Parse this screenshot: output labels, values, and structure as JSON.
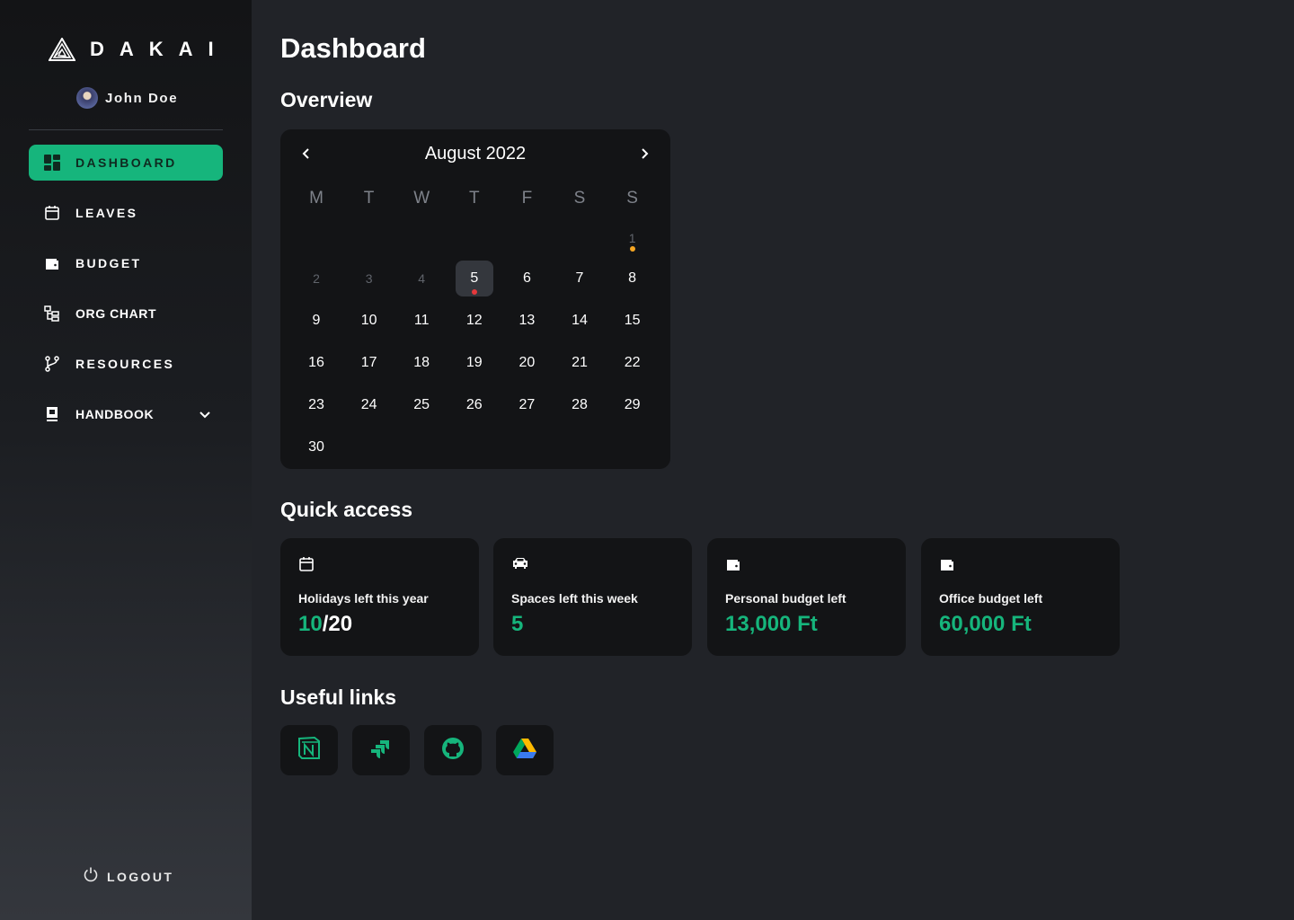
{
  "brand": {
    "name": "DAKAI"
  },
  "user": {
    "name": "John Doe"
  },
  "sidebar": {
    "items": [
      {
        "label": "DASHBOARD",
        "icon": "dashboard-icon",
        "active": true
      },
      {
        "label": "LEAVES",
        "icon": "calendar-icon"
      },
      {
        "label": "BUDGET",
        "icon": "wallet-icon"
      },
      {
        "label": "ORG CHART",
        "icon": "org-chart-icon"
      },
      {
        "label": "RESOURCES",
        "icon": "branch-icon"
      },
      {
        "label": "HANDBOOK",
        "icon": "book-icon",
        "expandable": true
      }
    ],
    "logout_label": "LOGOUT"
  },
  "page": {
    "title": "Dashboard",
    "overview_heading": "Overview",
    "quick_access_heading": "Quick access",
    "useful_links_heading": "Useful links"
  },
  "calendar": {
    "month_label": "August 2022",
    "weekdays": [
      "M",
      "T",
      "W",
      "T",
      "F",
      "S",
      "S"
    ],
    "rows": [
      [
        "",
        "",
        "",
        "",
        "",
        "",
        "1"
      ],
      [
        "2",
        "3",
        "4",
        "5",
        "6",
        "7",
        "8"
      ],
      [
        "9",
        "10",
        "11",
        "12",
        "13",
        "14",
        "15"
      ],
      [
        "16",
        "17",
        "18",
        "19",
        "20",
        "21",
        "22"
      ],
      [
        "23",
        "24",
        "25",
        "26",
        "27",
        "28",
        "29"
      ],
      [
        "30",
        "",
        "",
        "",
        "",
        "",
        ""
      ]
    ],
    "selected_day": "5",
    "event_colors": {
      "orange": "#f5a623",
      "red": "#e5383b"
    }
  },
  "quick_access": [
    {
      "label": "Holidays left this year",
      "value": "10",
      "value_suffix": "/20",
      "icon": "calendar-icon"
    },
    {
      "label": "Spaces left this week",
      "value": "5",
      "value_suffix": "",
      "icon": "car-icon"
    },
    {
      "label": "Personal budget left",
      "value": "13,000 Ft",
      "value_suffix": "",
      "icon": "wallet-icon"
    },
    {
      "label": "Office budget left",
      "value": "60,000 Ft",
      "value_suffix": "",
      "icon": "wallet-icon"
    }
  ],
  "useful_links": [
    {
      "icon": "notion-icon"
    },
    {
      "icon": "jira-icon"
    },
    {
      "icon": "github-icon"
    },
    {
      "icon": "google-drive-icon"
    }
  ],
  "colors": {
    "accent": "#16b57c",
    "background": "#212328",
    "card": "#131416"
  }
}
